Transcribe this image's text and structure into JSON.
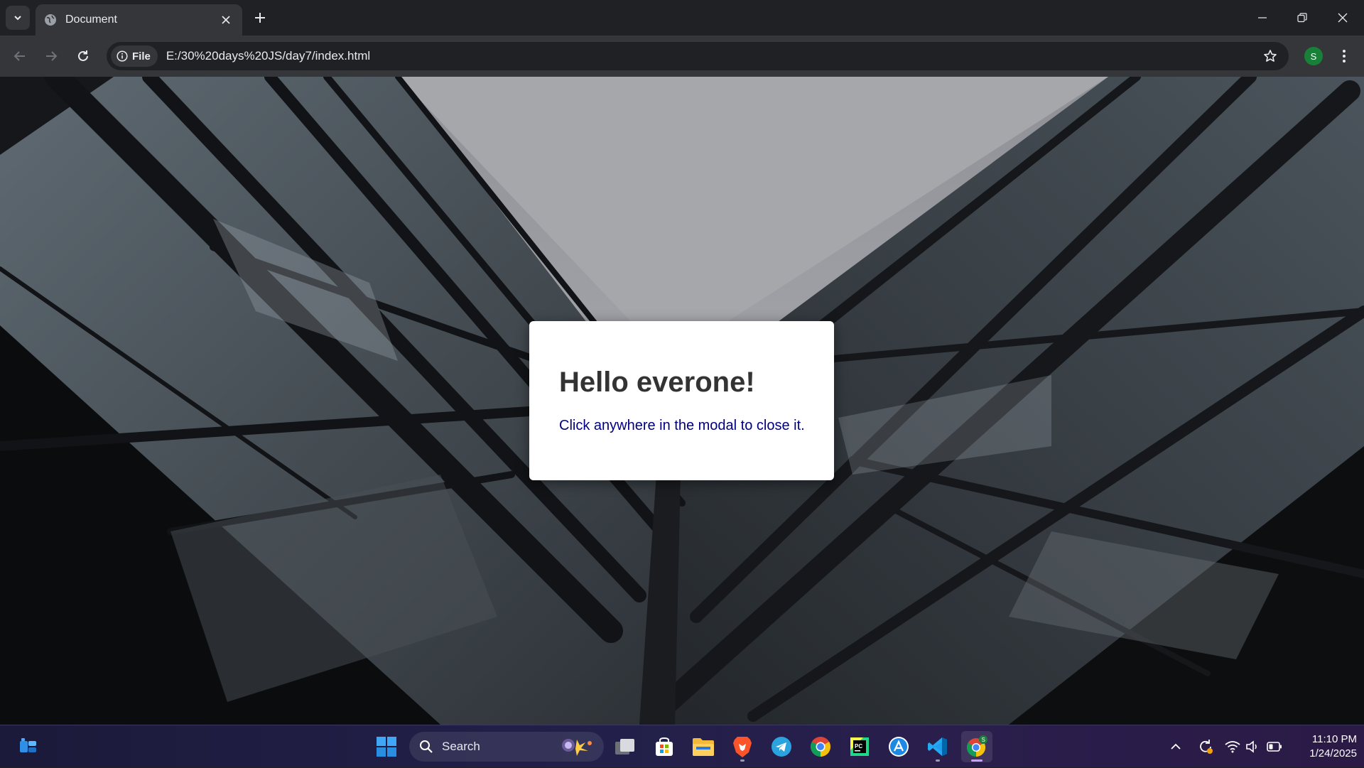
{
  "browser": {
    "tab": {
      "title": "Document"
    },
    "address": {
      "chip_label": "File",
      "url": "E:/30%20days%20JS/day7/index.html"
    },
    "profile_initial": "S"
  },
  "modal": {
    "heading": "Hello everone!",
    "text": "Click anywhere in the modal to close it."
  },
  "taskbar": {
    "search_label": "Search",
    "apps": [
      "widgets",
      "start",
      "search",
      "task-view",
      "microsoft-store",
      "file-explorer",
      "brave",
      "telegram",
      "chrome",
      "pycharm",
      "app-icon",
      "vscode",
      "chrome-profile"
    ],
    "time": "11:10 PM",
    "date": "1/24/2025"
  },
  "colors": {
    "modal_heading": "#333333",
    "modal_text": "#000080",
    "browser_frame": "#202124",
    "toolbar": "#35363a"
  }
}
